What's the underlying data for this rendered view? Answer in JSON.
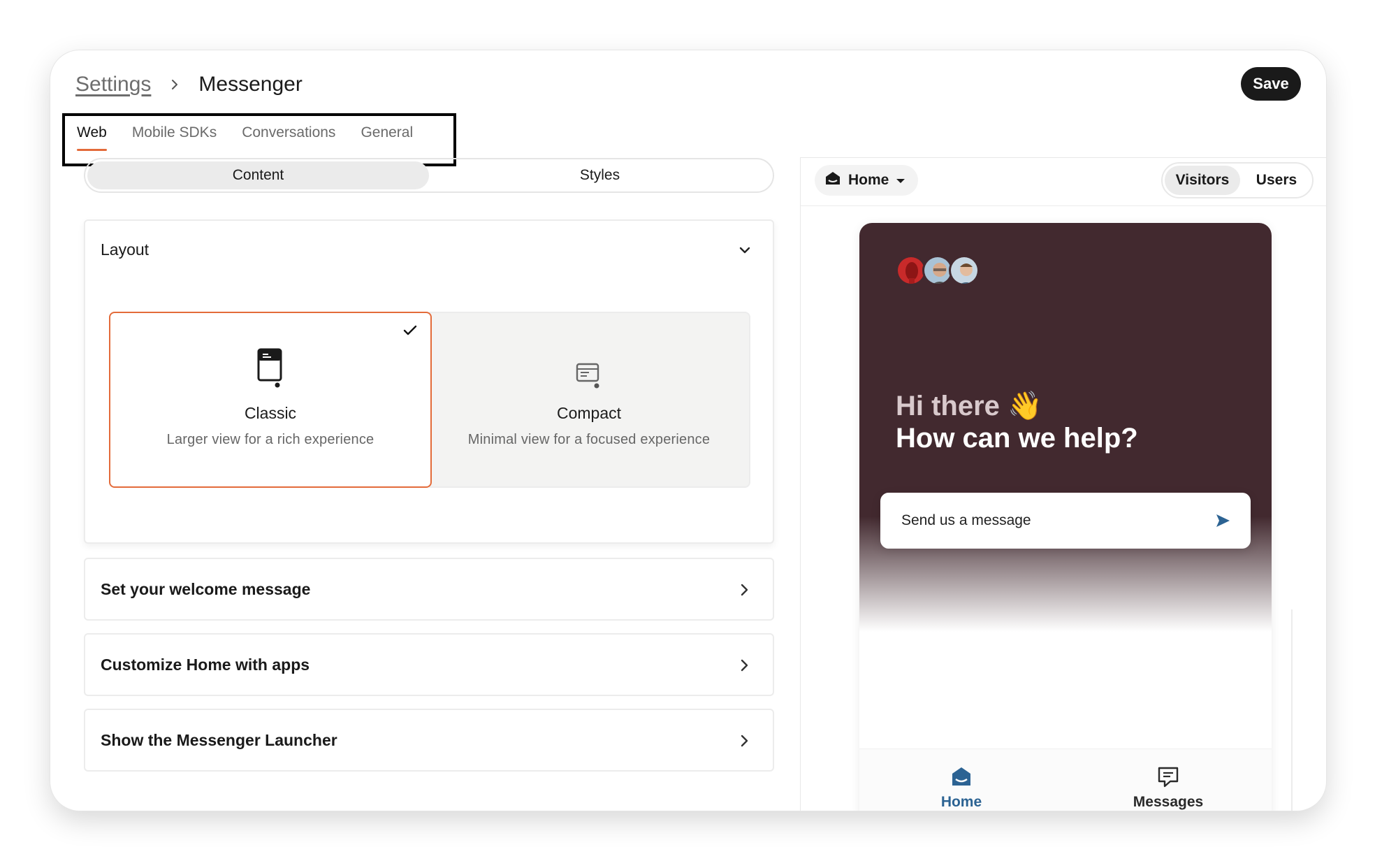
{
  "header": {
    "breadcrumb_parent": "Settings",
    "breadcrumb_current": "Messenger",
    "save_label": "Save"
  },
  "tabs": [
    {
      "label": "Web",
      "active": true
    },
    {
      "label": "Mobile SDKs",
      "active": false
    },
    {
      "label": "Conversations",
      "active": false
    },
    {
      "label": "General",
      "active": false
    }
  ],
  "editor": {
    "segments": [
      {
        "label": "Content",
        "active": true
      },
      {
        "label": "Styles",
        "active": false
      }
    ],
    "layout": {
      "title": "Layout",
      "options": [
        {
          "title": "Classic",
          "description": "Larger view for a rich experience",
          "selected": true
        },
        {
          "title": "Compact",
          "description": "Minimal view for a focused experience",
          "selected": false
        }
      ]
    },
    "sections": [
      {
        "label": "Set your welcome message"
      },
      {
        "label": "Customize Home with apps"
      },
      {
        "label": "Show the Messenger Launcher"
      }
    ]
  },
  "preview": {
    "page_dropdown": "Home",
    "audience": [
      {
        "label": "Visitors",
        "active": true
      },
      {
        "label": "Users",
        "active": false
      }
    ],
    "greeting": "Hi there 👋",
    "headline": "How can we help?",
    "message_prompt": "Send us a message",
    "nav": [
      {
        "label": "Home",
        "icon": "home-icon",
        "active": true
      },
      {
        "label": "Messages",
        "icon": "messages-icon",
        "active": false
      }
    ]
  },
  "colors": {
    "accent": "#e36b3a",
    "messenger_bg": "#42292f",
    "nav_active": "#2c6393",
    "send_icon": "#2c6393"
  }
}
